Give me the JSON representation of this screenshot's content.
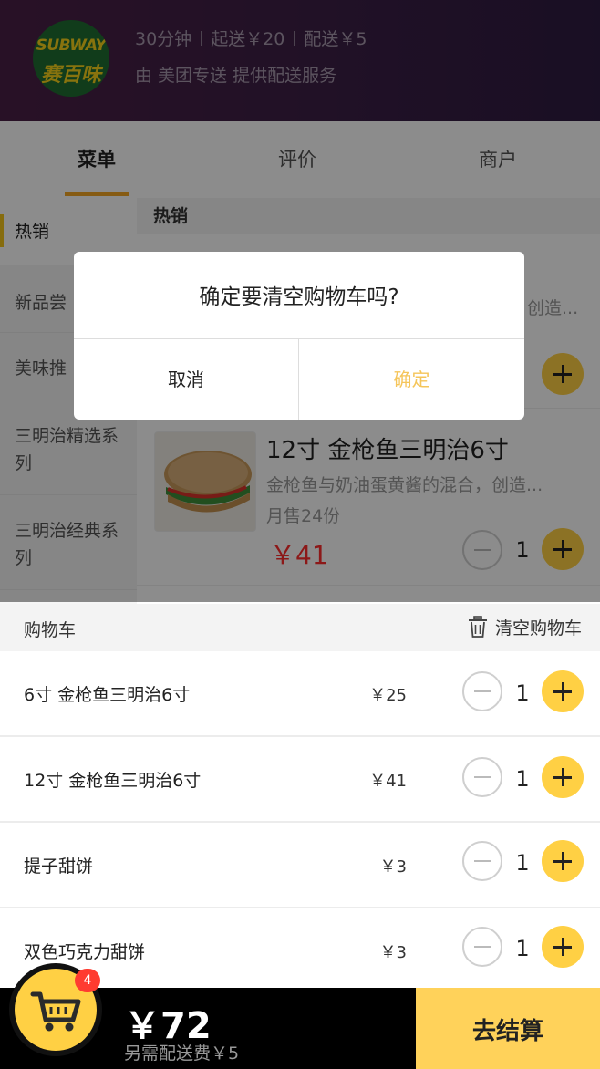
{
  "shop": {
    "logo_top": "SUBWAY",
    "logo_bottom": "赛百味",
    "delivery_time": "30分钟",
    "min_order": "起送￥20",
    "delivery_fee": "配送￥5",
    "delivery_provider": "由 美团专送 提供配送服务"
  },
  "tabs": [
    {
      "label": "菜单",
      "active": true
    },
    {
      "label": "评价",
      "active": false
    },
    {
      "label": "商户",
      "active": false
    }
  ],
  "sidebar": {
    "items": [
      {
        "label": "热销",
        "active": true
      },
      {
        "label": "新品尝"
      },
      {
        "label": "美味推"
      },
      {
        "label": "三明治精选系列"
      },
      {
        "label": "三明治经典系列"
      }
    ]
  },
  "menu": {
    "category": "热销",
    "partial_desc": "创造...",
    "dish": {
      "name": "12寸 金枪鱼三明治6寸",
      "desc": "金枪鱼与奶油蛋黄酱的混合，创造...",
      "sold": "月售24份",
      "price": "￥41",
      "qty": "1"
    }
  },
  "dialog": {
    "title": "确定要清空购物车吗?",
    "cancel": "取消",
    "confirm": "确定"
  },
  "cart": {
    "title": "购物车",
    "clear_label": "清空购物车",
    "items": [
      {
        "name": "6寸 金枪鱼三明治6寸",
        "price": "￥25",
        "qty": "1"
      },
      {
        "name": "12寸 金枪鱼三明治6寸",
        "price": "￥41",
        "qty": "1"
      },
      {
        "name": "提子甜饼",
        "price": "￥3",
        "qty": "1"
      },
      {
        "name": "双色巧克力甜饼",
        "price": "￥3",
        "qty": "1"
      }
    ],
    "badge_count": "4",
    "total": "￥72",
    "extra_fee": "另需配送费￥5",
    "checkout": "去结算"
  },
  "colors": {
    "accent": "#ffd044",
    "price_red": "#ff2d2d",
    "confirm_text": "#f5c55a"
  }
}
